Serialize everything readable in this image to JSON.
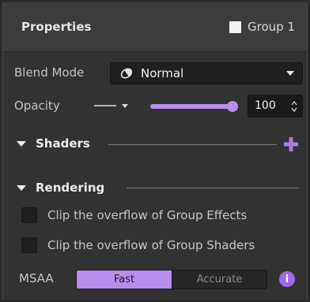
{
  "panel": {
    "title": "Properties",
    "group": {
      "label": "Group 1",
      "checked": true
    }
  },
  "blend": {
    "label": "Blend Mode",
    "value": "Normal",
    "icon": "blend-mode-icon"
  },
  "opacity": {
    "label": "Opacity",
    "value": "100",
    "fraction": 1.0,
    "stroke_icon": "stroke-style-icon"
  },
  "sections": {
    "shaders": {
      "label": "Shaders",
      "expanded": true
    },
    "rendering": {
      "label": "Rendering",
      "expanded": true
    }
  },
  "rendering": {
    "clip_effects": {
      "label": "Clip the overflow of Group Effects",
      "checked": false
    },
    "clip_shaders": {
      "label": "Clip the overflow of Group Shaders",
      "checked": false
    }
  },
  "msaa": {
    "label": "MSAA",
    "options": [
      "Fast",
      "Accurate"
    ],
    "selected": "Fast"
  },
  "colors": {
    "accent": "#b78ef0",
    "panel_bg": "#323232",
    "header_bg": "#3c3c3c",
    "field_bg": "#1f1f1f"
  }
}
